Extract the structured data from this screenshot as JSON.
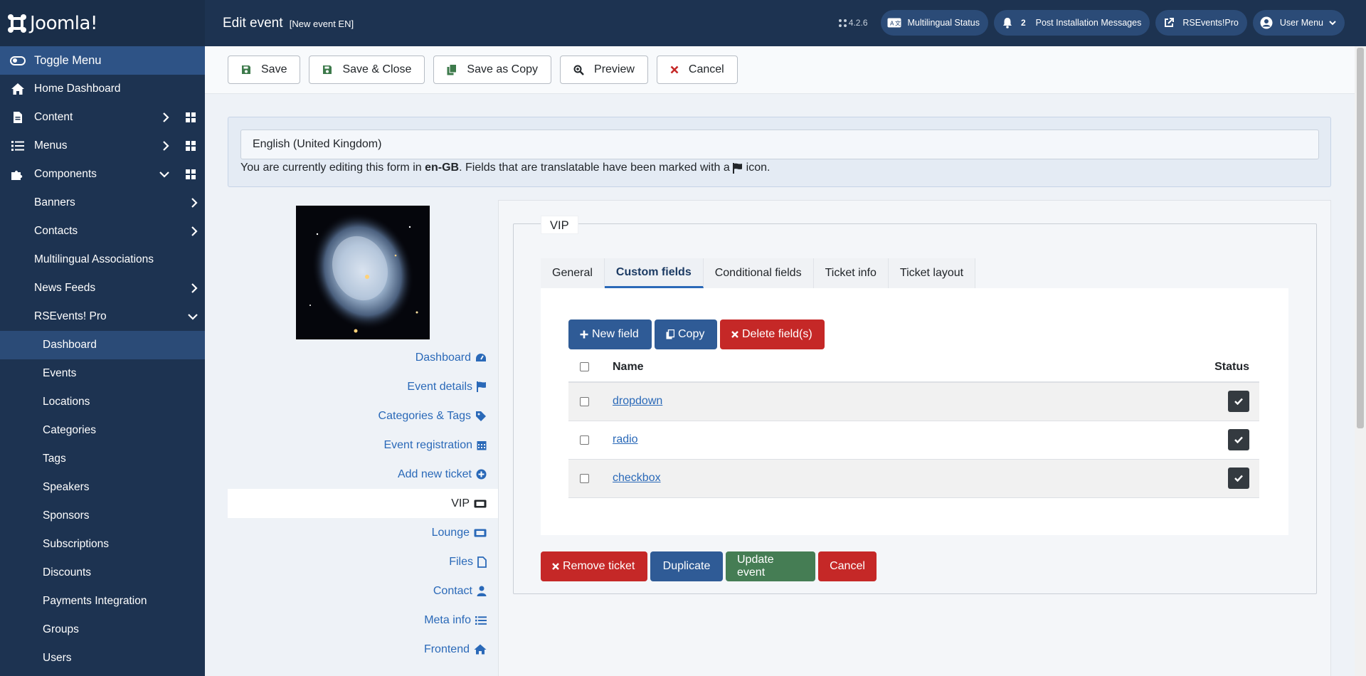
{
  "app": {
    "brand": "Joomla!",
    "version": "4.2.6"
  },
  "header": {
    "title": "Edit event",
    "subtitle": "[New event EN]",
    "pills": [
      {
        "label": "Multilingual Status",
        "icon": "language-icon"
      },
      {
        "label": "Post Installation Messages",
        "count": "2",
        "icon": "bell-icon"
      },
      {
        "label": "RSEvents!Pro",
        "icon": "external-link-icon"
      },
      {
        "label": "User Menu",
        "icon": "user-circle-icon"
      }
    ]
  },
  "sidebar": {
    "toggle": "Toggle Menu",
    "items": [
      {
        "label": "Home Dashboard",
        "icon": "home-icon"
      },
      {
        "label": "Content",
        "icon": "file-icon"
      },
      {
        "label": "Menus",
        "icon": "list-icon"
      },
      {
        "label": "Components",
        "icon": "puzzle-icon"
      }
    ],
    "components": [
      "Banners",
      "Contacts",
      "Multilingual Associations",
      "News Feeds",
      "RSEvents! Pro"
    ],
    "rsevents": [
      "Dashboard",
      "Events",
      "Locations",
      "Categories",
      "Tags",
      "Speakers",
      "Sponsors",
      "Subscriptions",
      "Discounts",
      "Payments Integration",
      "Groups",
      "Users"
    ]
  },
  "toolbar": {
    "save": "Save",
    "save_close": "Save & Close",
    "save_copy": "Save as Copy",
    "preview": "Preview",
    "cancel": "Cancel"
  },
  "language": {
    "selected": "English (United Kingdom)",
    "msg_before": "You are currently editing this form in ",
    "code": "en-GB",
    "msg_after": ". Fields that are translatable have been marked with a ",
    "msg_end": " icon."
  },
  "leftnav": {
    "items": [
      {
        "label": "Dashboard",
        "icon": "dashboard-icon"
      },
      {
        "label": "Event details",
        "icon": "flag-icon"
      },
      {
        "label": "Categories & Tags",
        "icon": "tag-icon"
      },
      {
        "label": "Event registration",
        "icon": "calendar-icon"
      },
      {
        "label": "Add new ticket",
        "icon": "plus-circle-icon"
      },
      {
        "label": "VIP",
        "icon": "ticket-icon"
      },
      {
        "label": "Lounge",
        "icon": "ticket-icon"
      },
      {
        "label": "Files",
        "icon": "file-icon"
      },
      {
        "label": "Contact",
        "icon": "user-icon"
      },
      {
        "label": "Meta info",
        "icon": "list-icon"
      },
      {
        "label": "Frontend",
        "icon": "home-icon"
      }
    ]
  },
  "ticket": {
    "legend": "VIP",
    "tabs": [
      "General",
      "Custom fields",
      "Conditional fields",
      "Ticket info",
      "Ticket layout"
    ],
    "actions": {
      "new": "New field",
      "copy": "Copy",
      "delete": "Delete field(s)"
    },
    "table": {
      "headers": {
        "name": "Name",
        "status": "Status"
      },
      "rows": [
        {
          "name": "dropdown"
        },
        {
          "name": "radio"
        },
        {
          "name": "checkbox"
        }
      ]
    },
    "buttons": {
      "remove": "Remove ticket",
      "duplicate": "Duplicate",
      "update": "Update event",
      "cancel": "Cancel"
    }
  },
  "colors": {
    "sidebar": "#1d3351",
    "primary": "#2f5b96",
    "danger": "#c52827",
    "success": "#457d54",
    "link": "#2a69b8"
  }
}
